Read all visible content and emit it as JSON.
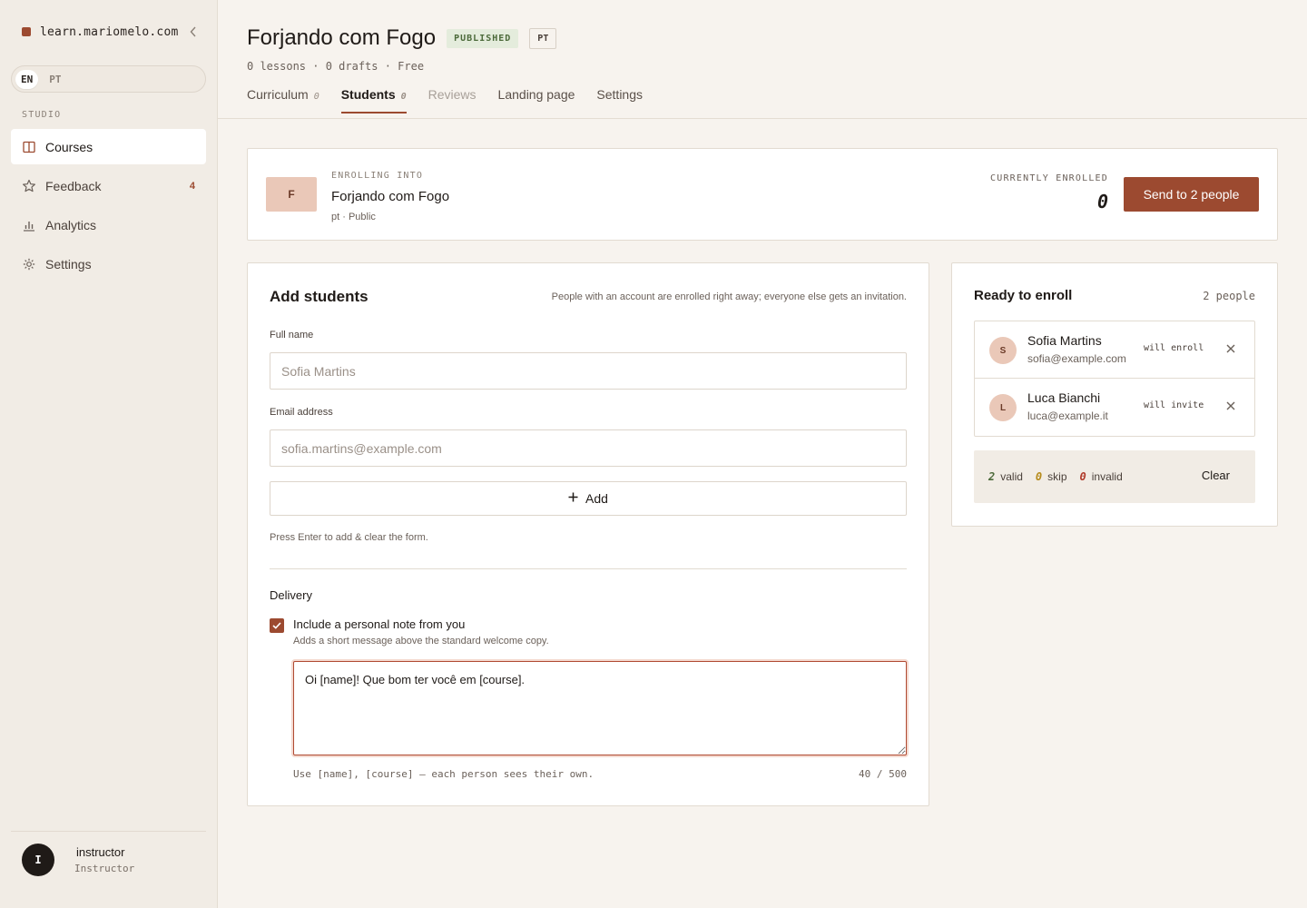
{
  "sidebar": {
    "brand": "learn.mariomelo.com",
    "languages": [
      "EN",
      "PT"
    ],
    "section_label": "STUDIO",
    "items": [
      {
        "label": "Courses",
        "icon": "book-icon",
        "active": true
      },
      {
        "label": "Feedback",
        "icon": "star-icon",
        "badge": "4"
      },
      {
        "label": "Analytics",
        "icon": "bar-chart-icon"
      },
      {
        "label": "Settings",
        "icon": "gear-icon"
      }
    ],
    "user": {
      "initial": "I",
      "name": "instructor",
      "role": "Instructor"
    }
  },
  "header": {
    "title": "Forjando com Fogo",
    "status_badge": "PUBLISHED",
    "lang_badge": "PT",
    "meta": "0 lessons · 0 drafts · Free",
    "tabs": [
      {
        "label": "Curriculum",
        "count": "0"
      },
      {
        "label": "Students",
        "count": "0",
        "active": true
      },
      {
        "label": "Reviews",
        "muted": true
      },
      {
        "label": "Landing page"
      },
      {
        "label": "Settings"
      }
    ]
  },
  "enroll": {
    "thumb_initial": "F",
    "label": "ENROLLING INTO",
    "course": "Forjando com Fogo",
    "sub": "pt · Public",
    "enrolled_label": "CURRENTLY ENROLLED",
    "enrolled_count": "0",
    "send_label": "Send to 2 people"
  },
  "add_students": {
    "title": "Add students",
    "hint": "People with an account are enrolled right away; everyone else gets an invitation.",
    "name_label": "Full name",
    "name_placeholder": "Sofia Martins",
    "email_label": "Email address",
    "email_placeholder": "sofia.martins@example.com",
    "add_label": "Add",
    "enter_hint": "Press Enter to add & clear the form.",
    "delivery_title": "Delivery",
    "note_checkbox_label": "Include a personal note from you",
    "note_checkbox_sub": "Adds a short message above the standard welcome copy.",
    "note_value": "Oi [name]! Que bom ter você em [course].",
    "note_hint": "Use [name], [course] — each person sees their own.",
    "note_count": "40 / 500"
  },
  "ready": {
    "title": "Ready to enroll",
    "count": "2 people",
    "people": [
      {
        "initial": "S",
        "name": "Sofia Martins",
        "email": "sofia@example.com",
        "status": "will enroll"
      },
      {
        "initial": "L",
        "name": "Luca Bianchi",
        "email": "luca@example.it",
        "status": "will invite"
      }
    ],
    "summary": {
      "valid_num": "2",
      "valid_label": "valid",
      "skip_num": "0",
      "skip_label": "skip",
      "invalid_num": "0",
      "invalid_label": "invalid",
      "clear_label": "Clear"
    }
  },
  "colors": {
    "accent": "#9c4a30",
    "valid": "#4c6a3a",
    "skip": "#b58a1a",
    "invalid": "#b03a2a",
    "published_bg": "#e4ecdc"
  }
}
